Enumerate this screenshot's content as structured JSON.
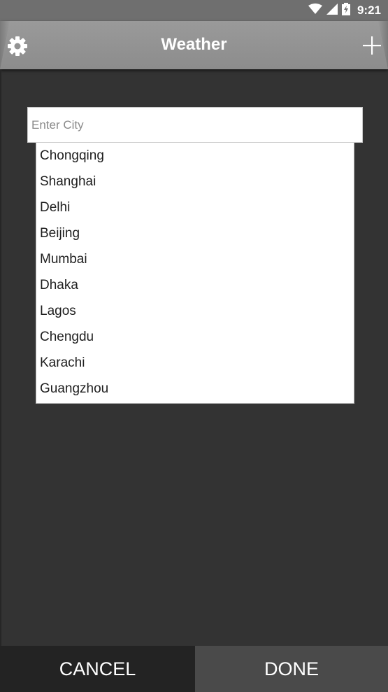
{
  "status_bar": {
    "time": "9:21",
    "icons": [
      "wifi-icon",
      "cell-signal-icon",
      "battery-charging-icon"
    ]
  },
  "app_bar": {
    "title": "Weather",
    "left_icon": "gear-icon",
    "right_icon": "plus-icon"
  },
  "search": {
    "placeholder": "Enter City",
    "value": ""
  },
  "suggestions": [
    "Chongqing",
    "Shanghai",
    "Delhi",
    "Beijing",
    "Mumbai",
    "Dhaka",
    "Lagos",
    "Chengdu",
    "Karachi",
    "Guangzhou"
  ],
  "actions": {
    "cancel_label": "CANCEL",
    "done_label": "DONE"
  },
  "colors": {
    "background": "#333333",
    "app_bar": "#959595",
    "status_bar": "#6f6f6f",
    "cancel_bg": "#232323",
    "done_bg": "#4a4a4a"
  }
}
